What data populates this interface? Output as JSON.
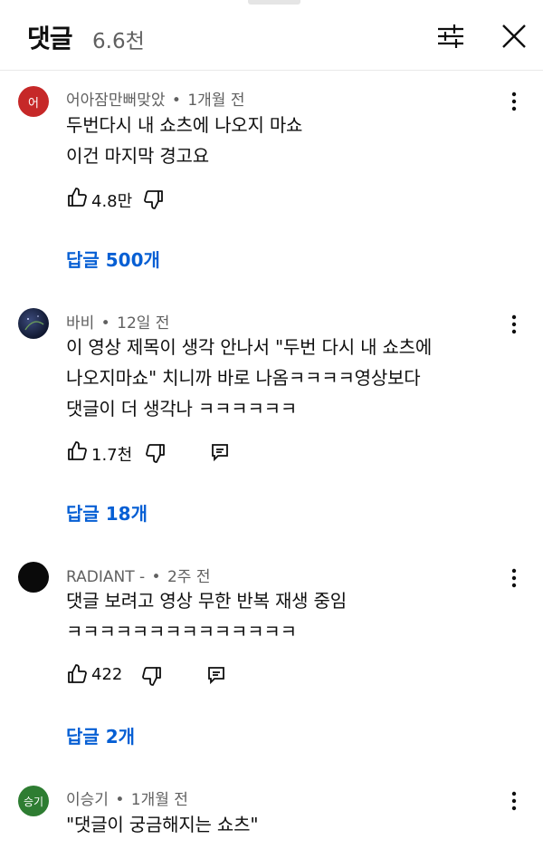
{
  "header": {
    "title": "댓글",
    "count": "6.6천"
  },
  "icons": {
    "filter": "sliders-icon",
    "close": "close-icon",
    "more": "more-vertical-icon",
    "like": "thumb-up-icon",
    "dislike": "thumb-down-icon",
    "reply": "reply-icon"
  },
  "colors": {
    "link": "#065fd4",
    "meta": "#606060",
    "avatar_0": "#c62828",
    "avatar_2": "#0a0a0a",
    "avatar_3": "#2e7d32"
  },
  "comments": [
    {
      "avatar_text": "어",
      "author": "어아잠만뻐맞았",
      "time": "1개월 전",
      "text": "두번다시 내 쇼츠에 나오지 마쇼\n이건 마지막 경고요",
      "likes": "4.8만",
      "replies": "답글 500개"
    },
    {
      "avatar_text": "",
      "author": "바비",
      "time": "12일 전",
      "text": "이 영상 제목이 생각 안나서 \"두번 다시 내 쇼츠에\n나오지마쇼\" 치니까 바로 나옴ㅋㅋㅋㅋ영상보다\n댓글이 더 생각나 ㅋㅋㅋㅋㅋㅋ",
      "likes": "1.7천",
      "replies": "답글 18개"
    },
    {
      "avatar_text": "",
      "author": "RADIANT -",
      "time": "2주 전",
      "text": "댓글 보려고 영상 무한 반복 재생 중임\nㅋㅋㅋㅋㅋㅋㅋㅋㅋㅋㅋㅋㅋㅋ",
      "likes": "422",
      "replies": "답글 2개"
    },
    {
      "avatar_text": "승기",
      "author": "이승기",
      "time": "1개월 전",
      "text": "\"댓글이 궁금해지는 쇼츠\""
    }
  ]
}
